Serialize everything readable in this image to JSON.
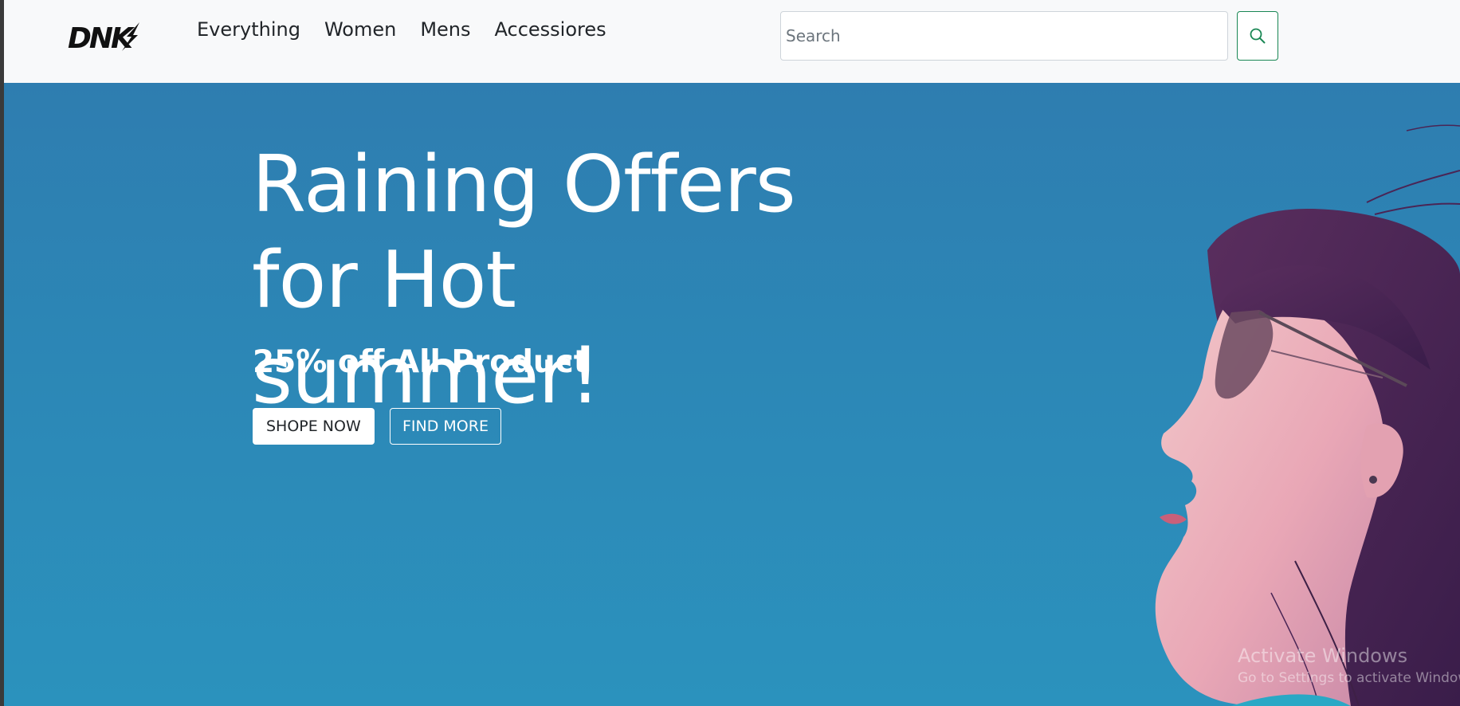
{
  "navbar": {
    "brand": "DNK",
    "links": [
      "Everything",
      "Women",
      "Mens",
      "Accessiores"
    ],
    "search": {
      "placeholder": "Search",
      "value": ""
    },
    "search_icon": "search-icon"
  },
  "hero": {
    "title": "Raining Offers for Hot summer!",
    "subtitle": "25% off All Product",
    "primary_button": "SHOPE NOW",
    "secondary_button": "FIND MORE",
    "image": "woman-with-sunglasses-portrait"
  },
  "watermark": {
    "title": "Activate Windows",
    "subtitle": "Go to Settings to activate Windows."
  },
  "colors": {
    "hero_background": "#2c87b6",
    "search_button_border": "#198754",
    "navbar_background": "#f8f9fa"
  }
}
